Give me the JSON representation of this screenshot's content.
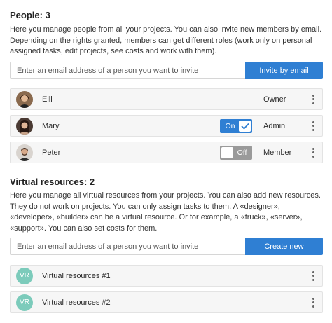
{
  "people": {
    "title": "People: 3",
    "description": "Here you manage people from all your projects. You can also invite new members by email. Depending on the rights granted, members can get different roles (work only on personal assigned tasks, edit projects, see costs and work with them).",
    "invite_placeholder": "Enter an email address of a person you want to invite",
    "invite_button": "Invite by email",
    "members": [
      {
        "name": "Elli",
        "role": "Owner",
        "avatar": "avatar-elli"
      },
      {
        "name": "Mary",
        "role": "Admin",
        "avatar": "avatar-mary",
        "toggle": {
          "label": "On",
          "state": "on",
          "icon": "check-icon"
        }
      },
      {
        "name": "Peter",
        "role": "Member",
        "avatar": "avatar-peter",
        "toggle": {
          "label": "Off",
          "state": "off"
        }
      }
    ]
  },
  "virtual": {
    "title": "Virtual resources: 2",
    "description": "Here you manage all virtual resources from your projects. You can also add new resources. They do not work on projects. You can only assign tasks to them. A «designer», «developer», «builder» can be a virtual resource. Or for example, a «truck», «server», «support». You can also set costs for them.",
    "invite_placeholder": "Enter an email address of a person you want to invite",
    "create_button": "Create new",
    "resources": [
      {
        "initials": "VR",
        "name": "Virtual resources #1"
      },
      {
        "initials": "VR",
        "name": "Virtual resources #2"
      }
    ]
  },
  "colors": {
    "accent": "#2f7fd3",
    "toggle_off": "#9a9a9a",
    "vr_avatar": "#7ccbbb",
    "row_bg": "#f6f6f6"
  }
}
